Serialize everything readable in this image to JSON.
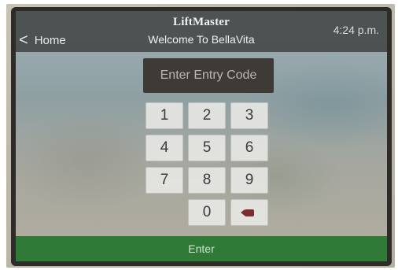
{
  "header": {
    "back_label": "Home",
    "back_chevron": "<",
    "brand": "LiftMaster",
    "welcome": "Welcome To BellaVita",
    "time": "4:24 p.m."
  },
  "entry": {
    "placeholder": "Enter Entry Code"
  },
  "keypad": {
    "keys": [
      "1",
      "2",
      "3",
      "4",
      "5",
      "6",
      "7",
      "8",
      "9",
      "0"
    ],
    "delete_icon": "backspace-icon"
  },
  "enter_button": {
    "label": "Enter"
  },
  "colors": {
    "header_bg": "#464a4a",
    "code_box_bg": "#3e3a36",
    "enter_bg": "#2f7a37",
    "delete_icon": "#7b2c2c"
  }
}
